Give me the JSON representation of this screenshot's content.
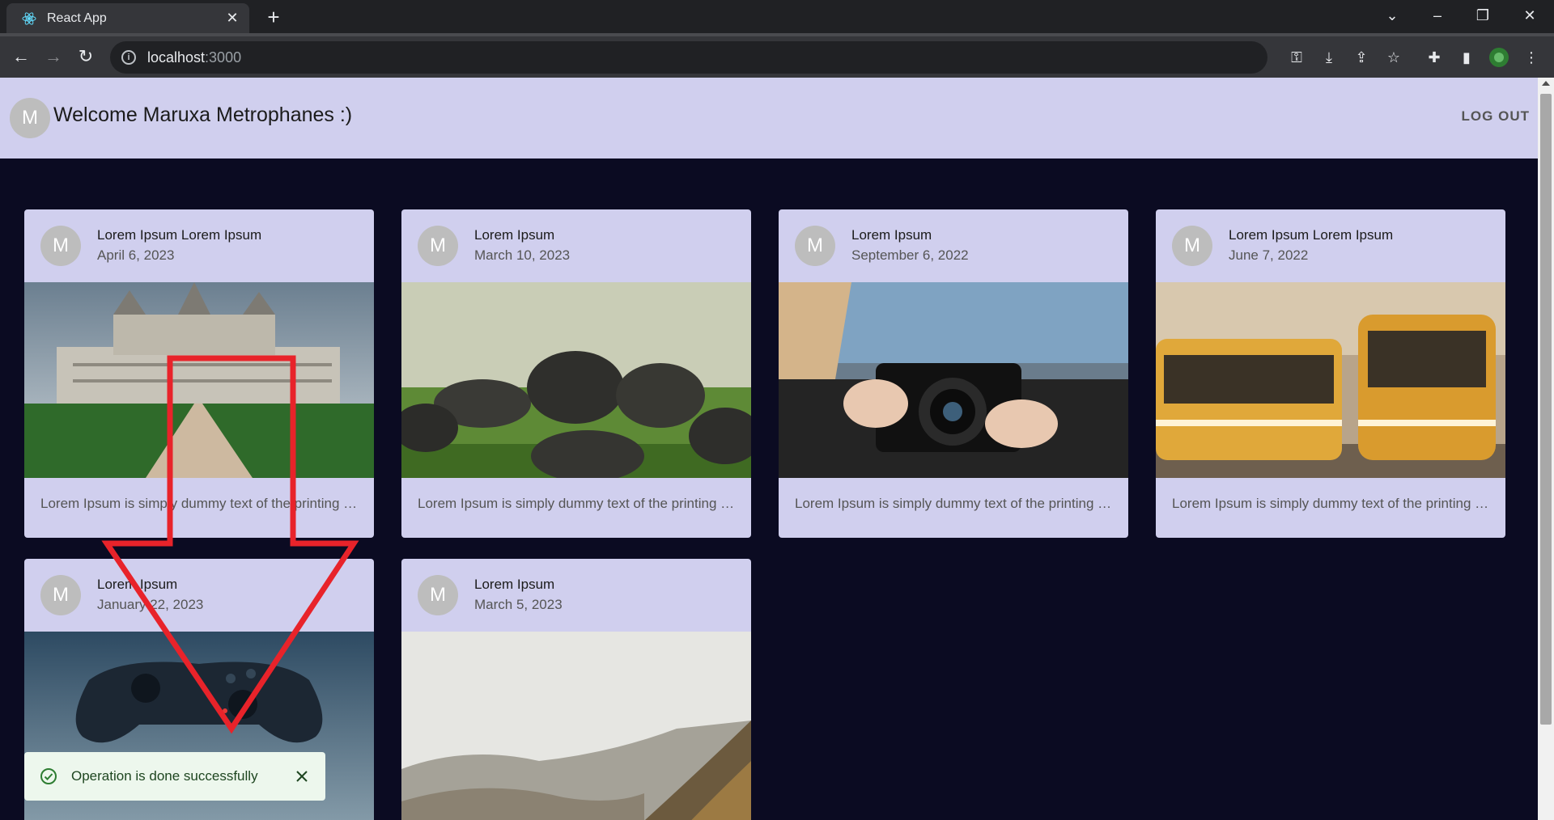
{
  "browser": {
    "tab_title": "React App",
    "url_host": "localhost",
    "url_port": ":3000"
  },
  "appbar": {
    "avatar_letter": "M",
    "welcome": "Welcome Maruxa Metrophanes :)",
    "logout_label": "LOG OUT"
  },
  "cards": [
    {
      "avatar": "M",
      "title": "Lorem Ipsum Lorem Ipsum",
      "date": "April 6, 2023",
      "description": "Lorem Ipsum is simply dummy text of the printing and typesetting industry",
      "image": "castle"
    },
    {
      "avatar": "M",
      "title": "Lorem Ipsum",
      "date": "March 10, 2023",
      "description": "Lorem Ipsum is simply dummy text of the printing and typesetting industry",
      "image": "stones"
    },
    {
      "avatar": "M",
      "title": "Lorem Ipsum",
      "date": "September 6, 2022",
      "description": "Lorem Ipsum is simply dummy text of the printing and typesetting industry",
      "image": "camera"
    },
    {
      "avatar": "M",
      "title": "Lorem Ipsum Lorem Ipsum",
      "date": "June 7, 2022",
      "description": "Lorem Ipsum is simply dummy text of the printing and typesetting industry",
      "image": "trams"
    },
    {
      "avatar": "M",
      "title": "Lorem Ipsum",
      "date": "January 22, 2023",
      "description": "",
      "image": "gamepad"
    },
    {
      "avatar": "M",
      "title": "Lorem Ipsum",
      "date": "March 5, 2023",
      "description": "",
      "image": "hills"
    }
  ],
  "toast": {
    "message": "Operation is done successfully"
  },
  "colors": {
    "appbar_bg": "#d0cfee",
    "page_bg": "#0b0b22",
    "annotation_arrow": "#e8232a",
    "toast_bg": "#edf7ed",
    "toast_text": "#1e4620"
  }
}
